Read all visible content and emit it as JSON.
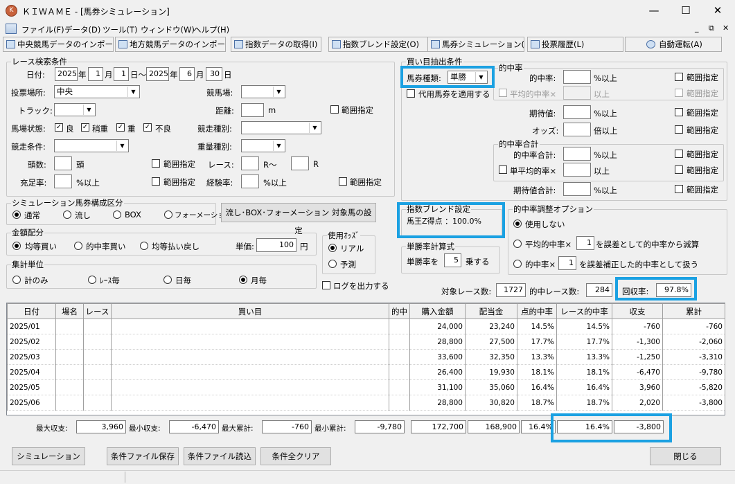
{
  "app": {
    "title": "ＫＩＷＡＭＥ - [馬券シミュレーション]",
    "icon": "kiwame-logo-icon"
  },
  "menu": [
    "ファイル(F)",
    "データ(D)",
    "ツール(T)",
    "ウィンドウ(W)",
    "ヘルプ(H)"
  ],
  "toolbar": [
    "中央競馬データのインポート(J)",
    "地方競馬データのインポート(N)",
    "指数データの取得(I)",
    "指数ブレンド設定(O)",
    "馬券シミュレーション(B)",
    "投票履歴(L)",
    "自動運転(A)"
  ],
  "search": {
    "legend": "レース検索条件",
    "date_label": "日付:",
    "from_year": "2025",
    "year1": "年",
    "from_month": "1",
    "month1": "月",
    "from_day": "1",
    "day1": "日〜",
    "to_year": "2025",
    "year2": "年",
    "to_month": "6",
    "month2": "月",
    "to_day": "30",
    "day2": "日",
    "venue_label": "投票場所:",
    "venue": "中央",
    "course_label": "競馬場:",
    "track_label": "トラック:",
    "dist_label": "距離:",
    "dist_unit": "m",
    "range": "範囲指定",
    "cond_label": "馬場状態:",
    "c1": "良",
    "c2": "稍重",
    "c3": "重",
    "c4": "不良",
    "race_type_label": "競走種別:",
    "race_cond_label": "競走条件:",
    "weight_label": "重量種別:",
    "heads_label": "頭数:",
    "heads_unit": "頭",
    "race_label": "レース:",
    "r_from": "R〜",
    "r_to": "R",
    "fill_label": "充足率:",
    "pct_up": "%以上",
    "exp_label": "経験率:"
  },
  "sim": {
    "legend": "シミュレーション馬券構成区分",
    "o1": "通常",
    "o2": "流し",
    "o3": "BOX",
    "o4": "フォーメーション",
    "setbtn": "流し･BOX･フォーメーション 対象馬の設定"
  },
  "amount": {
    "legend": "金額配分",
    "o1": "均等買い",
    "o2": "的中率買い",
    "o3": "均等払い戻し",
    "unit_label": "単価:",
    "unit": "100",
    "yen": "円"
  },
  "odds": {
    "legend": "使用ｵｯｽﾞ",
    "o1": "リアル",
    "o2": "予測"
  },
  "agg": {
    "legend": "集計単位",
    "o1": "計のみ",
    "o2": "ﾚｰｽ毎",
    "o3": "日毎",
    "o4": "月毎"
  },
  "log_label": "ログを出力する",
  "buy": {
    "legend": "買い目抽出条件",
    "type_label": "馬券種類:",
    "type": "単勝",
    "sub": "代用馬券を適用する",
    "hit_legend": "的中率",
    "hit": "的中率:",
    "pct_up": "%以上",
    "avg_hit": "平均的中率×",
    "up": "以上",
    "exp": "期待値:",
    "odds": "オッズ:",
    "odds_up": "倍以上",
    "range": "範囲指定",
    "sum_legend": "的中率合計",
    "hit_sum": "的中率合計:",
    "single_avg": "単平均的率×",
    "exp_sum": "期待値合計:"
  },
  "blend": {
    "legend": "指数ブレンド設定",
    "text": "馬王Z得点 ：100.0%"
  },
  "calc": {
    "legend": "単勝率計算式",
    "pre": "単勝率を",
    "val": "5",
    "post": "乗する"
  },
  "adj": {
    "legend": "的中率調整オプション",
    "o1": "使用しない",
    "o2a": "平均的中率×",
    "o2v": "1",
    "o2b": "を誤差として的中率から減算",
    "o3a": "的中率×",
    "o3v": "1",
    "o3b": "を誤差補正した的中率として扱う"
  },
  "stats": {
    "races_label": "対象レース数:",
    "races": "1727",
    "hit_label": "的中レース数:",
    "hit": "284",
    "ret_label": "回収率:",
    "ret": "97.8%"
  },
  "table": {
    "headers": [
      "日付",
      "場名",
      "レース",
      "買い目",
      "的中",
      "購入金額",
      "配当金",
      "点的中率",
      "レース的中率",
      "収支",
      "累計"
    ],
    "rows": [
      [
        "2025/01",
        "",
        "",
        "",
        "",
        "24,000",
        "23,240",
        "14.5%",
        "14.5%",
        "-760",
        "-760"
      ],
      [
        "2025/02",
        "",
        "",
        "",
        "",
        "28,800",
        "27,500",
        "17.7%",
        "17.7%",
        "-1,300",
        "-2,060"
      ],
      [
        "2025/03",
        "",
        "",
        "",
        "",
        "33,600",
        "32,350",
        "13.3%",
        "13.3%",
        "-1,250",
        "-3,310"
      ],
      [
        "2025/04",
        "",
        "",
        "",
        "",
        "26,400",
        "19,930",
        "18.1%",
        "18.1%",
        "-6,470",
        "-9,780"
      ],
      [
        "2025/05",
        "",
        "",
        "",
        "",
        "31,100",
        "35,060",
        "16.4%",
        "16.4%",
        "3,960",
        "-5,820"
      ],
      [
        "2025/06",
        "",
        "",
        "",
        "",
        "28,800",
        "30,820",
        "18.7%",
        "18.7%",
        "2,020",
        "-3,800"
      ]
    ]
  },
  "totals": {
    "max_inc_label": "最大収支:",
    "max_inc": "3,960",
    "min_inc_label": "最小収支:",
    "min_inc": "-6,470",
    "max_cum_label": "最大累計:",
    "max_cum": "-760",
    "min_cum_label": "最小累計:",
    "min_cum": "-9,780",
    "buy": "172,700",
    "pay": "168,900",
    "pt": "16.4%",
    "race": "16.4%",
    "cum": "-3,800"
  },
  "buttons": {
    "sim": "シミュレーション",
    "save": "条件ファイル保存",
    "load": "条件ファイル読込",
    "clear": "条件全クリア",
    "close": "閉じる"
  }
}
